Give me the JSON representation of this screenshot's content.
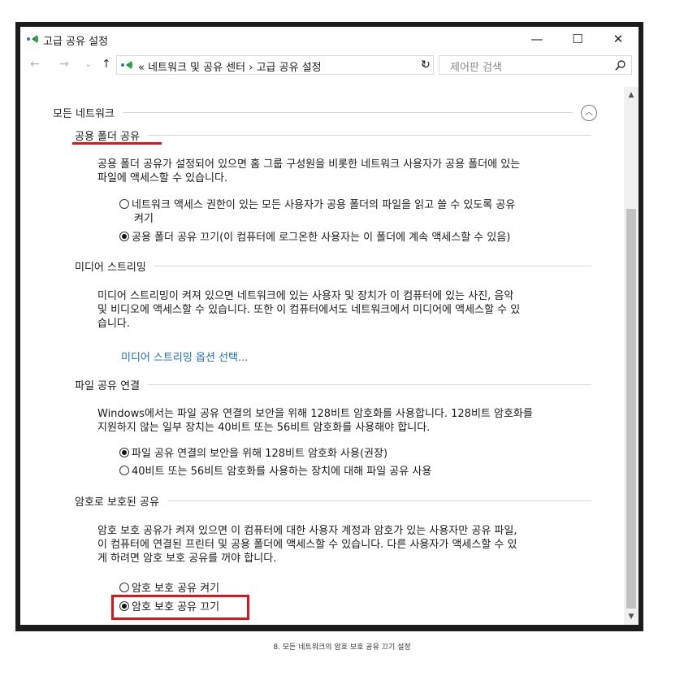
{
  "window": {
    "title": "고급 공유 설정",
    "minimize": "—",
    "maximize": "☐",
    "close": "✕"
  },
  "nav": {
    "back": "←",
    "forward": "→",
    "history": "⌄",
    "up": "↑",
    "address": "« 네트워크 및 공유 센터 › 고급 공유 설정",
    "address_dropdown": "⌄",
    "refresh": "↻",
    "search_placeholder": "제어판 검색"
  },
  "content": {
    "all_networks": "모든 네트워크",
    "sections": [
      {
        "title": "공용 폴더 공유",
        "description": [
          "공용 폴더 공유가 설정되어 있으면 홈 그룹 구성원을 비롯한 네트워크 사용자가 공용 폴더에 있는",
          "파일에 액세스할 수 있습니다."
        ],
        "options": [
          {
            "label": [
              "네트워크 액세스 권한이 있는 모든 사용자가 공용 폴더의 파일을 읽고 쓸 수 있도록 공유",
              "켜기"
            ],
            "selected": false
          },
          {
            "label": [
              "공용 폴더 공유 끄기(이 컴퓨터에 로그온한 사용자는 이 폴더에 계속 액세스할 수 있음)"
            ],
            "selected": true
          }
        ]
      },
      {
        "title": "미디어 스트리밍",
        "description": [
          "미디어 스트리밍이 켜져 있으면 네트워크에 있는 사용자 및 장치가 이 컴퓨터에 있는 사진, 음악",
          "및 비디오에 액세스할 수 있습니다. 또한 이 컴퓨터에서도 네트워크에서 미디어에 액세스할 수 있",
          "습니다."
        ],
        "link": "미디어 스트리밍 옵션 선택..."
      },
      {
        "title": "파일 공유 연결",
        "description": [
          "Windows에서는 파일 공유 연결의 보안을 위해 128비트 암호화를 사용합니다. 128비트 암호화를",
          "지원하지 않는 일부 장치는 40비트 또는 56비트 암호화를 사용해야 합니다."
        ],
        "options": [
          {
            "label": [
              "파일 공유 연결의 보안을 위해 128비트 암호화 사용(권장)"
            ],
            "selected": true
          },
          {
            "label": [
              "40비트 또는 56비트 암호화를 사용하는 장치에 대해 파일 공유 사용"
            ],
            "selected": false
          }
        ]
      },
      {
        "title": "암호로 보호된 공유",
        "description": [
          "암호 보호 공유가 켜져 있으면 이 컴퓨터에 대한 사용자 계정과 암호가 있는 사용자만 공유 파일,",
          "이 컴퓨터에 연결된 프린터 및 공용 폴더에 액세스할 수 있습니다. 다른 사용자가 액세스할 수 있",
          "게 하려면 암호 보호 공유를 꺼야 합니다."
        ],
        "options": [
          {
            "label": [
              "암호 보호 공유 켜기"
            ],
            "selected": false
          },
          {
            "label": [
              "암호 보호 공유 끄기"
            ],
            "selected": true
          }
        ]
      }
    ]
  },
  "caption": "8. 모든 네트워크의 암호 보호 공유 끄기 설정",
  "colors": {
    "highlight": "#e3121b",
    "link": "#1a6fc4"
  }
}
